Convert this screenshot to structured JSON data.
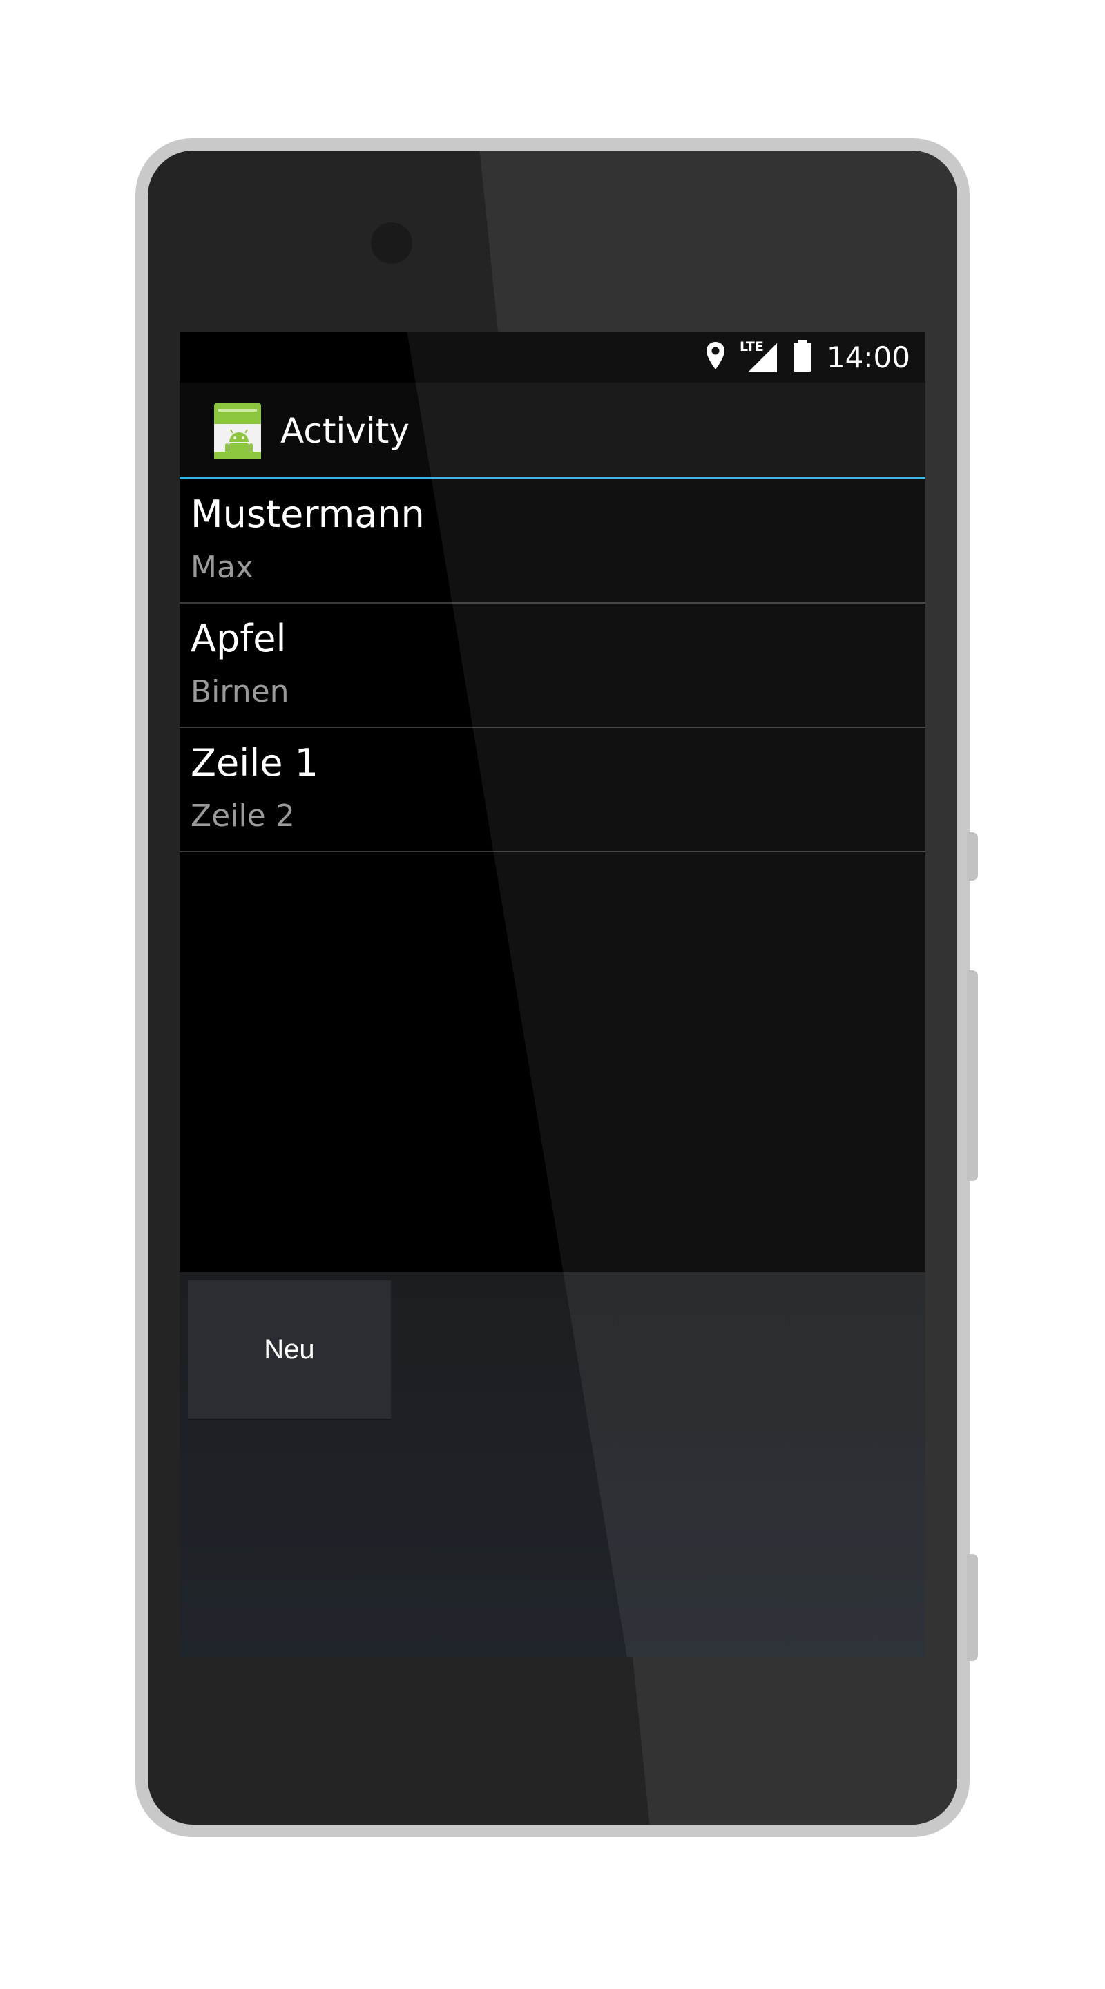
{
  "status_bar": {
    "time": "14:00",
    "network_label": "LTE",
    "icons": [
      "location-icon",
      "lte-signal-icon",
      "battery-icon"
    ]
  },
  "action_bar": {
    "title": "Activity",
    "icon": "android-app-icon",
    "accent_color": "#33b5e5"
  },
  "list": {
    "items": [
      {
        "title": "Mustermann",
        "subtitle": "Max"
      },
      {
        "title": "Apfel",
        "subtitle": "Birnen"
      },
      {
        "title": "Zeile 1",
        "subtitle": "Zeile 2"
      }
    ]
  },
  "bottom": {
    "new_button_label": "Neu"
  }
}
